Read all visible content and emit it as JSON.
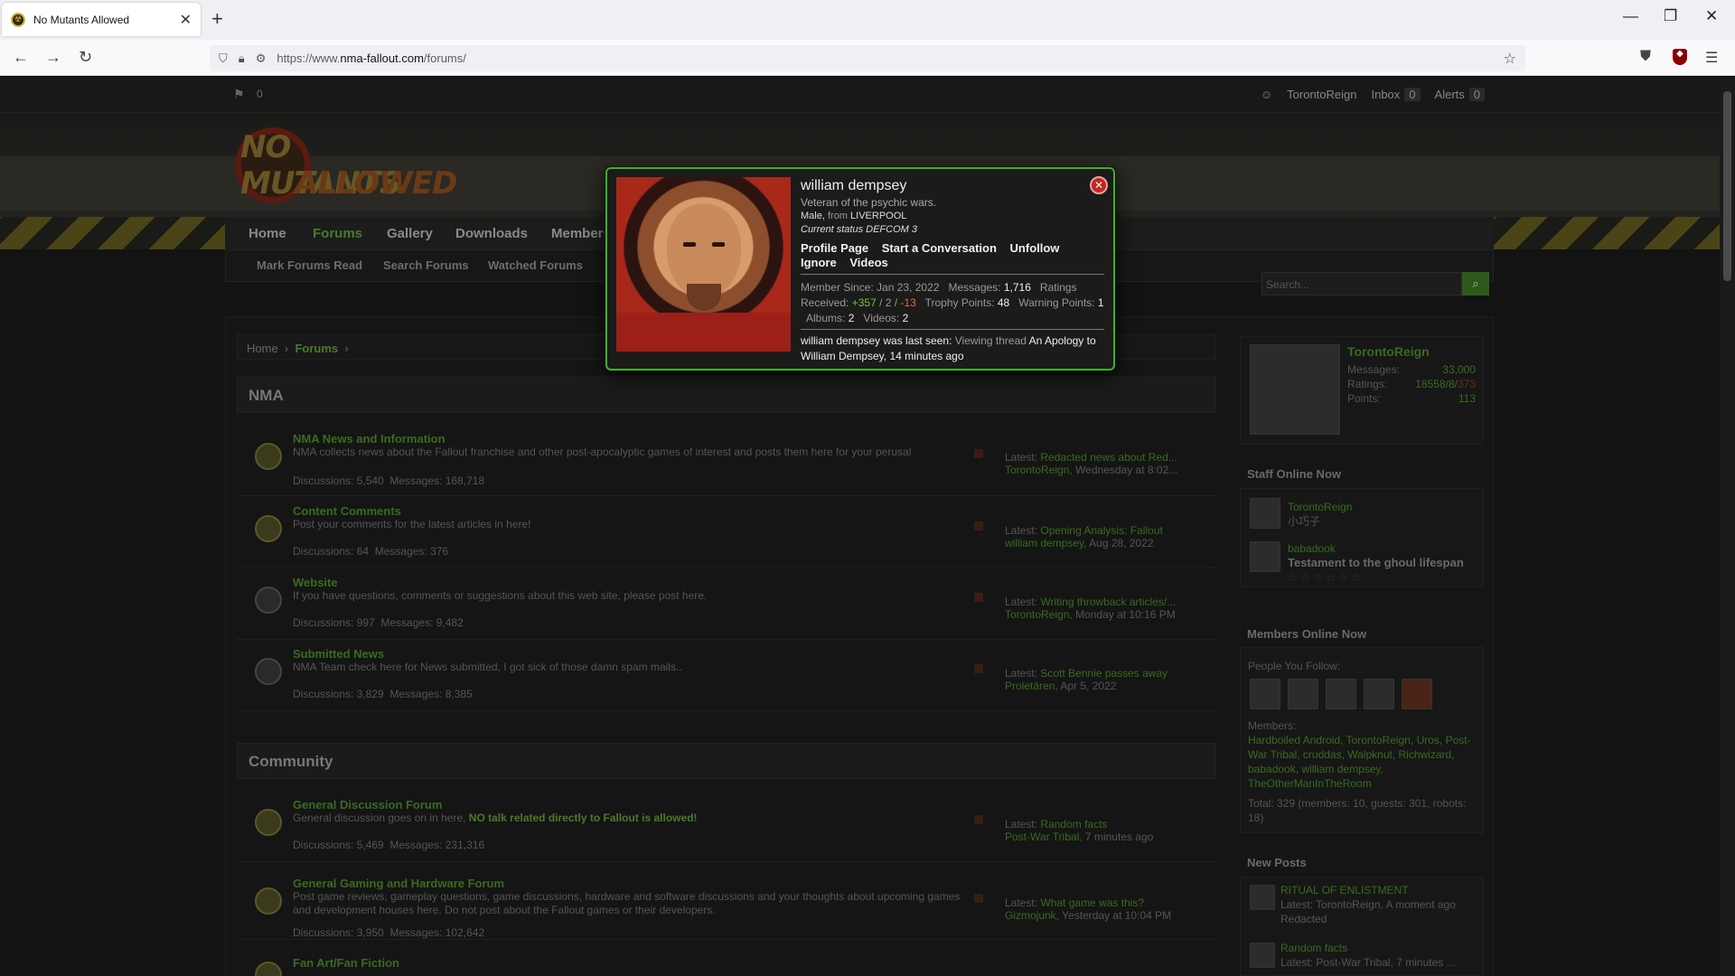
{
  "browser": {
    "tab_title": "No Mutants Allowed",
    "url_prefix": "https://www.",
    "url_domain": "nma-fallout.com",
    "url_path": "/forums/"
  },
  "topbar": {
    "flag_count": "0",
    "username": "TorontoReign",
    "inbox_label": "Inbox",
    "inbox_count": "0",
    "alerts_label": "Alerts",
    "alerts_count": "0"
  },
  "logo": {
    "line1": "NO MUTANTS",
    "line2": "ALLOWED"
  },
  "nav": {
    "items": [
      "Home",
      "Forums",
      "Gallery",
      "Downloads",
      "Members"
    ],
    "active": "Forums"
  },
  "subnav": {
    "items": [
      "Mark Forums Read",
      "Search Forums",
      "Watched Forums"
    ],
    "search_placeholder": "Search..."
  },
  "breadcrumbs": {
    "home": "Home",
    "current": "Forums"
  },
  "categories": [
    {
      "name": "NMA",
      "forums": [
        {
          "name": "NMA News and Information",
          "desc": "NMA collects news about the Fallout franchise and other post-apocalyptic games of interest and posts them here for your perusal",
          "discussions": "Discussions: 5,540",
          "messages": "Messages: 168,718",
          "latest_title": "Redacted news about Red...",
          "latest_by": "TorontoReign,",
          "latest_when": "Wednesday at 8:02..."
        },
        {
          "name": "Content Comments",
          "desc": "Post your comments for the latest articles in here!",
          "discussions": "Discussions: 64",
          "messages": "Messages: 376",
          "latest_title": "Opening Analysis: Fallout",
          "latest_by": "william dempsey,",
          "latest_when": "Aug 28, 2022"
        },
        {
          "name": "Website",
          "desc": "If you have questions, comments or suggestions about this web site, please post here.",
          "discussions": "Discussions: 997",
          "messages": "Messages: 9,482",
          "latest_title": "Writing throwback articles/...",
          "latest_by": "TorontoReign,",
          "latest_when": "Monday at 10:16 PM"
        },
        {
          "name": "Submitted News",
          "desc": "NMA Team check here for News submitted, I got sick of those damn spam mails..",
          "discussions": "Discussions: 3,829",
          "messages": "Messages: 8,385",
          "latest_title": "Scott Bennie passes away",
          "latest_by": "Proletären,",
          "latest_when": "Apr 5, 2022"
        }
      ]
    },
    {
      "name": "Community",
      "forums": [
        {
          "name": "General Discussion Forum",
          "desc": "General discussion goes on in here,",
          "desc_hl": "NO talk related directly to Fallout is allowed!",
          "discussions": "Discussions: 5,469",
          "messages": "Messages: 231,316",
          "latest_title": "Random facts",
          "latest_by": "Post-War Tribal,",
          "latest_when": "7 minutes ago"
        },
        {
          "name": "General Gaming and Hardware Forum",
          "desc": "Post game reviews, gameplay questions, game discussions, hardware and software discussions and your thoughts about upcoming games and development houses here. Do not post about the Fallout games or their developers.",
          "discussions": "Discussions: 3,950",
          "messages": "Messages: 102,642",
          "latest_title": "What game was this?",
          "latest_by": "Gizmojunk,",
          "latest_when": "Yesterday at 10:04 PM"
        },
        {
          "name": "Fan Art/Fan Fiction"
        }
      ]
    }
  ],
  "latest_prefix": "Latest:",
  "sidebar": {
    "profile": {
      "name": "TorontoReign",
      "messages_label": "Messages:",
      "messages": "33,000",
      "ratings_label": "Ratings:",
      "ratings": "18558/8/",
      "ratings_neg": "373",
      "points_label": "Points:",
      "points": "113"
    },
    "staff_title": "Staff Online Now",
    "staff": [
      {
        "name": "TorontoReign",
        "sub": "小巧子"
      },
      {
        "name": "babadook",
        "sub": "Testament to the ghoul lifespan"
      }
    ],
    "members_title": "Members Online Now",
    "follow_label": "People You Follow:",
    "members_label": "Members:",
    "members_list": "Hardboiled Android, TorontoReign, Uros, Post-War Tribal, cruddas, Walpknut, Richwizard, babadook, william dempsey, TheOtherManInTheRoom",
    "total": "Total: 329 (members: 10, guests: 301, robots: 18)",
    "newposts_title": "New Posts",
    "newposts": [
      {
        "title": "RITUAL OF ENLISTMENT",
        "meta": "Latest: TorontoReign, A moment ago",
        "sub": "Redacted"
      },
      {
        "title": "Random facts",
        "meta": "Latest: Post-War Tribal, 7 minutes ..."
      }
    ]
  },
  "tooltip": {
    "name": "william dempsey",
    "title": "Veteran of the psychic wars.",
    "gender": "Male,",
    "from_label": "from",
    "location": "LIVERPOOL",
    "status": "Current status DEFCOM 3",
    "links": [
      "Profile Page",
      "Start a Conversation",
      "Unfollow",
      "Ignore",
      "Videos"
    ],
    "member_since_label": "Member Since:",
    "member_since": "Jan 23, 2022",
    "messages_label": "Messages:",
    "messages": "1,716",
    "ratings_label": "Ratings Received:",
    "ratings_pos": "+357",
    "ratings_neutral": "2",
    "ratings_neg": "-13",
    "trophy_label": "Trophy Points:",
    "trophy": "48",
    "warning_label": "Warning Points:",
    "warning": "1",
    "albums_label": "Albums:",
    "albums": "2",
    "videos_label": "Videos:",
    "videos": "2",
    "seen_label": "william dempsey was last seen:",
    "seen_action": "Viewing thread",
    "seen_thread": "An Apology to William Dempsey,",
    "seen_when": "14 minutes ago"
  }
}
